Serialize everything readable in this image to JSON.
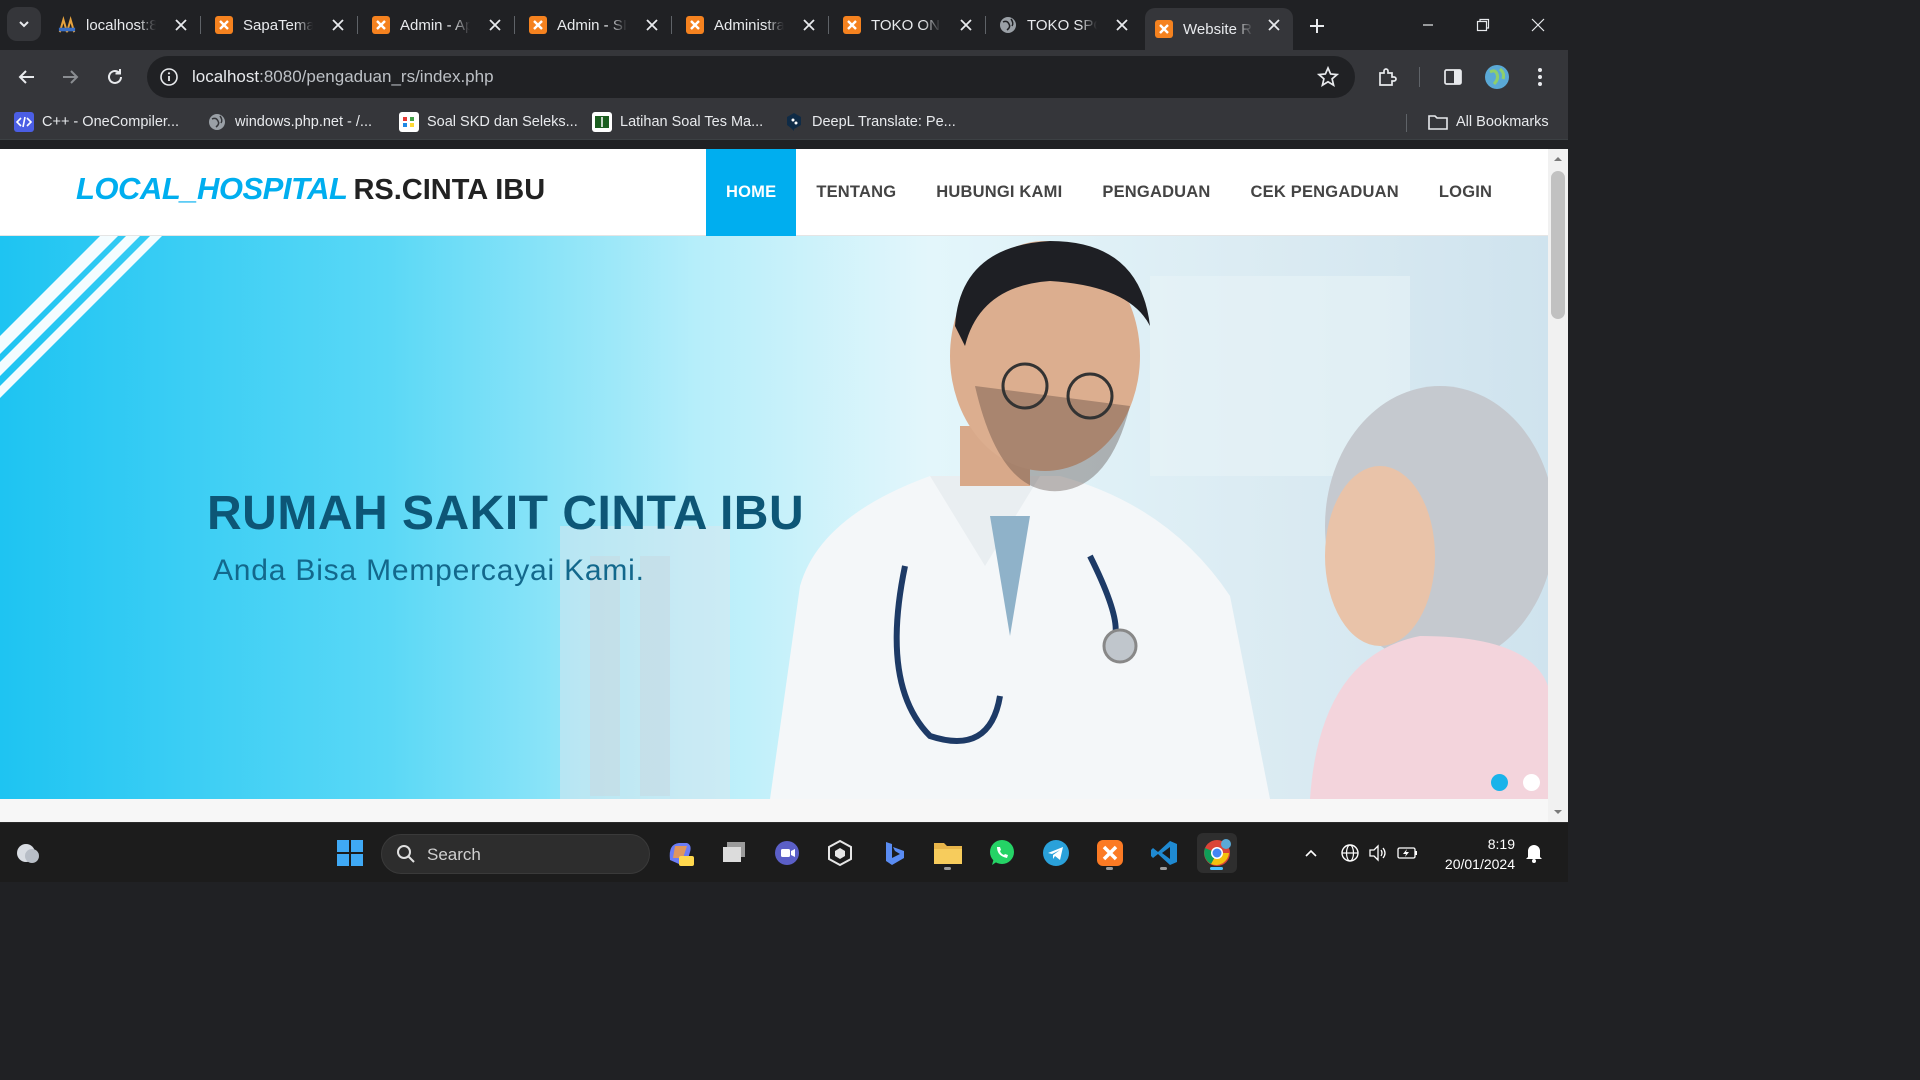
{
  "browser": {
    "tabs": [
      {
        "title": "localhost:8",
        "icon": "xampp-orange-icon",
        "active": false
      },
      {
        "title": "SapaTeman",
        "icon": "xampp-icon",
        "active": false
      },
      {
        "title": "Admin - Ap",
        "icon": "xampp-icon",
        "active": false
      },
      {
        "title": "Admin - SI",
        "icon": "xampp-icon",
        "active": false
      },
      {
        "title": "Administra",
        "icon": "xampp-icon",
        "active": false
      },
      {
        "title": "TOKO ONL",
        "icon": "xampp-icon",
        "active": false
      },
      {
        "title": "TOKO SPO",
        "icon": "globe-icon",
        "active": false
      },
      {
        "title": "Website RS",
        "icon": "xampp-icon",
        "active": true
      }
    ],
    "url_host": "localhost",
    "url_rest": ":8080/pengaduan_rs/index.php",
    "bookmarks": [
      {
        "label": "C++ - OneCompiler...",
        "icon": "code-icon"
      },
      {
        "label": "windows.php.net - /...",
        "icon": "globe-icon"
      },
      {
        "label": "Soal SKD dan Seleks...",
        "icon": "quiz-icon"
      },
      {
        "label": "Latihan Soal Tes Ma...",
        "icon": "book-icon"
      },
      {
        "label": "DeepL Translate: Pe...",
        "icon": "deepl-icon"
      }
    ],
    "all_bookmarks": "All Bookmarks"
  },
  "site": {
    "brand": "LOCAL_HOSPITAL",
    "brand_sub": "RS.CINTA IBU",
    "menu": [
      "HOME",
      "TENTANG",
      "HUBUNGI KAMI",
      "PENGADUAN",
      "CEK PENGADUAN",
      "LOGIN"
    ],
    "active_menu": "HOME",
    "hero_title": "RUMAH SAKIT CINTA IBU",
    "hero_subtitle": "Anda Bisa Mempercayai Kami.",
    "slide_count": 2,
    "active_slide": 1,
    "accent": "#00aeef"
  },
  "taskbar": {
    "search_label": "Search",
    "time": "8:19",
    "date": "20/01/2024"
  }
}
